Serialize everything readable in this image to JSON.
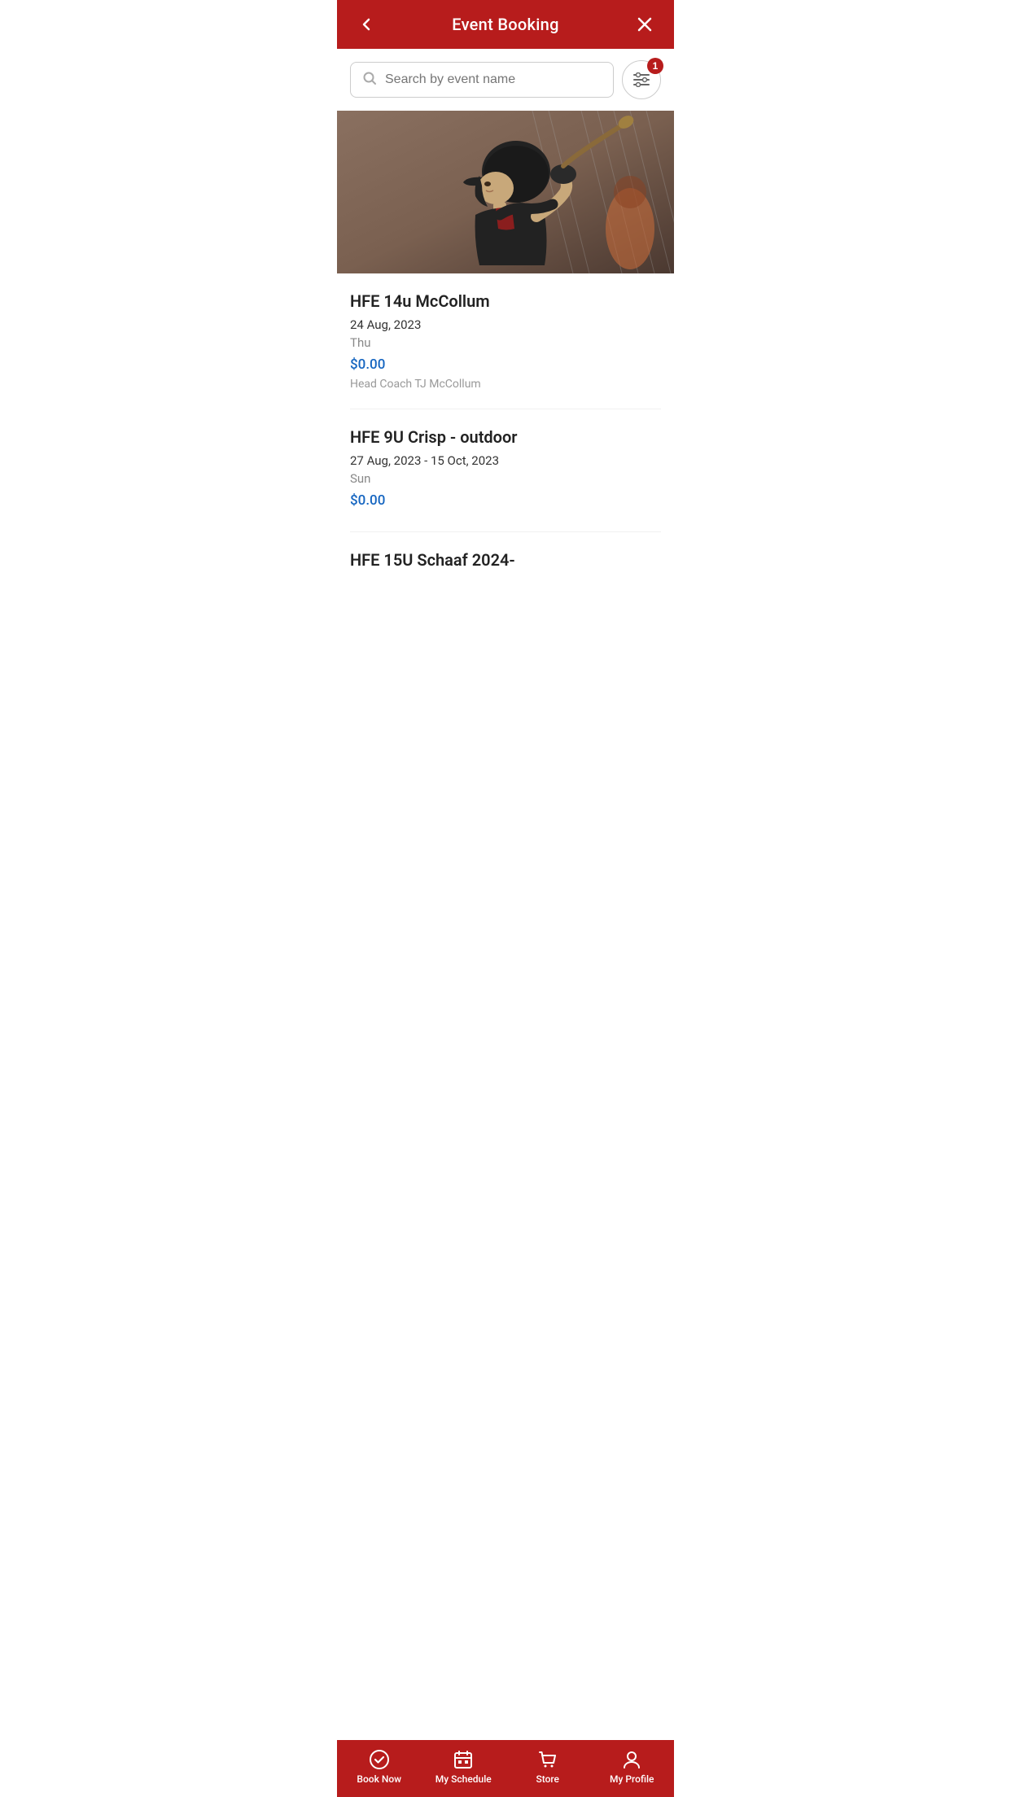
{
  "header": {
    "title": "Event Booking",
    "back_label": "‹",
    "close_label": "✕"
  },
  "search": {
    "placeholder": "Search by event name",
    "filter_badge": "1"
  },
  "events": [
    {
      "id": 1,
      "name": "HFE 14u McCollum",
      "date": "24 Aug, 2023",
      "day": "Thu",
      "price": "$0.00",
      "coach": "Head Coach TJ McCollum"
    },
    {
      "id": 2,
      "name": "HFE 9U Crisp - outdoor",
      "date": "27 Aug, 2023 - 15 Oct, 2023",
      "day": "Sun",
      "price": "$0.00",
      "coach": ""
    },
    {
      "id": 3,
      "name": "HFE 15U Schaaf 2024-",
      "date": "",
      "day": "",
      "price": "",
      "coach": ""
    }
  ],
  "bottom_nav": [
    {
      "id": "book_now",
      "label": "Book Now",
      "icon": "check-circle"
    },
    {
      "id": "my_schedule",
      "label": "My Schedule",
      "icon": "calendar"
    },
    {
      "id": "store",
      "label": "Store",
      "icon": "cart"
    },
    {
      "id": "my_profile",
      "label": "My Profile",
      "icon": "person"
    }
  ],
  "colors": {
    "primary": "#b71c1c",
    "price_color": "#1565c0"
  }
}
